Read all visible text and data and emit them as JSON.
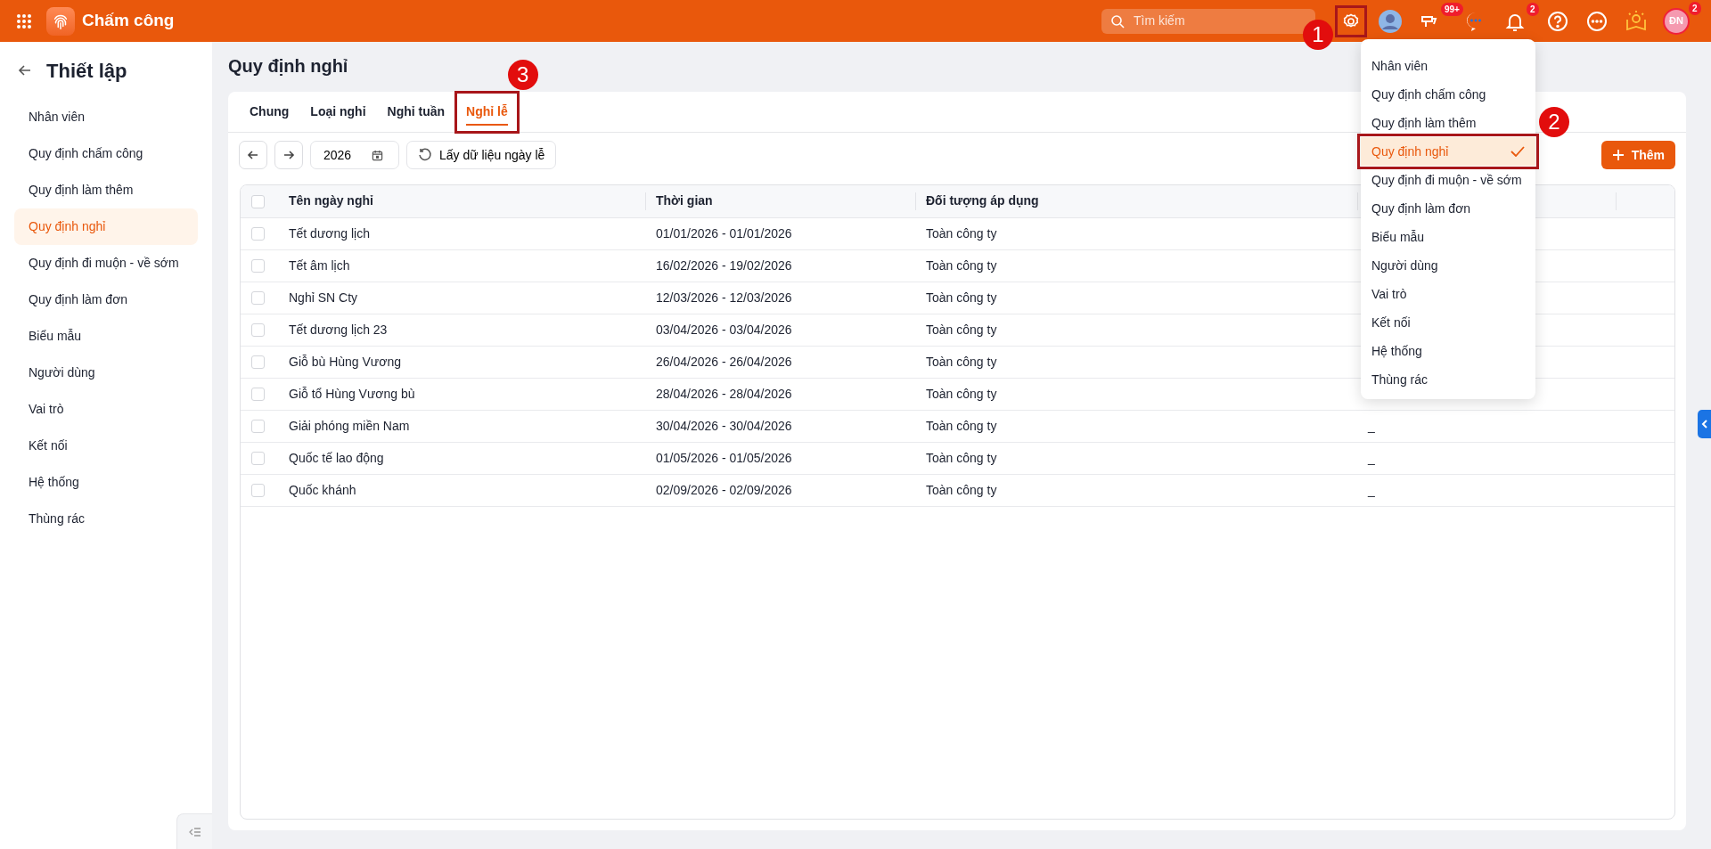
{
  "app": {
    "title": "Chấm công"
  },
  "topbar": {
    "search": {
      "placeholder": "Tìm kiếm"
    },
    "settings_annotation": "1",
    "tools_badge": "99+",
    "notifications_badge": "2",
    "user": {
      "initials": "ĐN",
      "badge": "2"
    }
  },
  "settings_menu": [
    {
      "label": "Nhân viên",
      "selected": false
    },
    {
      "label": "Quy định chấm công",
      "selected": false
    },
    {
      "label": "Quy định làm thêm",
      "selected": false
    },
    {
      "label": "Quy định nghỉ",
      "selected": true,
      "annotation": "2"
    },
    {
      "label": "Quy định đi muộn - về sớm",
      "selected": false
    },
    {
      "label": "Quy định làm đơn",
      "selected": false
    },
    {
      "label": "Biểu mẫu",
      "selected": false
    },
    {
      "label": "Người dùng",
      "selected": false
    },
    {
      "label": "Vai trò",
      "selected": false
    },
    {
      "label": "Kết nối",
      "selected": false
    },
    {
      "label": "Hệ thống",
      "selected": false
    },
    {
      "label": "Thùng rác",
      "selected": false
    }
  ],
  "sidebar": {
    "title": "Thiết lập",
    "items": [
      {
        "label": "Nhân viên",
        "selected": false
      },
      {
        "label": "Quy định chấm công",
        "selected": false
      },
      {
        "label": "Quy định làm thêm",
        "selected": false
      },
      {
        "label": "Quy định nghỉ",
        "selected": true
      },
      {
        "label": "Quy định đi muộn - về sớm",
        "selected": false
      },
      {
        "label": "Quy định làm đơn",
        "selected": false
      },
      {
        "label": "Biểu mẫu",
        "selected": false
      },
      {
        "label": "Người dùng",
        "selected": false
      },
      {
        "label": "Vai trò",
        "selected": false
      },
      {
        "label": "Kết nối",
        "selected": false
      },
      {
        "label": "Hệ thống",
        "selected": false
      },
      {
        "label": "Thùng rác",
        "selected": false
      }
    ]
  },
  "page": {
    "title": "Quy định nghỉ"
  },
  "tabs": [
    {
      "label": "Chung",
      "selected": false
    },
    {
      "label": "Loại nghỉ",
      "selected": false
    },
    {
      "label": "Nghỉ tuần",
      "selected": false
    },
    {
      "label": "Nghỉ lễ",
      "selected": true,
      "annotation": "3"
    }
  ],
  "toolbar": {
    "year": "2026",
    "fetch_button": "Lấy dữ liệu ngày lễ",
    "add_button": "Thêm"
  },
  "table": {
    "select_all_checked": false,
    "columns": [
      "Tên ngày nghỉ",
      "Thời gian",
      "Đối tượng áp dụng"
    ],
    "rows": [
      {
        "name": "Tết dương lịch",
        "time": "01/01/2026 - 01/01/2026",
        "target": "Toàn công ty",
        "checked": false
      },
      {
        "name": "Tết âm lịch",
        "time": "16/02/2026 - 19/02/2026",
        "target": "Toàn công ty",
        "checked": false
      },
      {
        "name": "Nghỉ SN Cty",
        "time": "12/03/2026 - 12/03/2026",
        "target": "Toàn công ty",
        "checked": false
      },
      {
        "name": "Tết dương lịch 23",
        "time": "03/04/2026 - 03/04/2026",
        "target": "Toàn công ty",
        "checked": false
      },
      {
        "name": "Giỗ bù Hùng Vương",
        "time": "26/04/2026 - 26/04/2026",
        "target": "Toàn công ty",
        "checked": false
      },
      {
        "name": "Giỗ tổ Hùng Vương bù",
        "time": "28/04/2026 - 28/04/2026",
        "target": "Toàn công ty",
        "checked": false
      },
      {
        "name": "Giải phóng miền Nam",
        "time": "30/04/2026 - 30/04/2026",
        "target": "Toàn công ty",
        "column_4": "_",
        "checked": false
      },
      {
        "name": "Quốc tế lao động",
        "time": "01/05/2026 - 01/05/2026",
        "target": "Toàn công ty",
        "column_4": "_",
        "checked": false
      },
      {
        "name": "Quốc khánh",
        "time": "02/09/2026 - 02/09/2026",
        "target": "Toàn công ty",
        "column_4": "_",
        "checked": false
      }
    ]
  }
}
